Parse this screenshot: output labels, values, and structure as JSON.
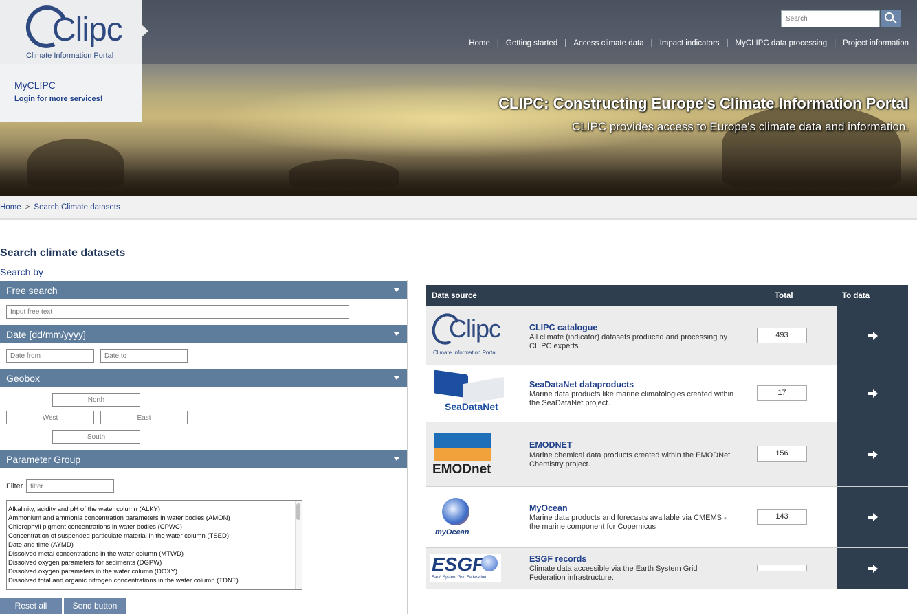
{
  "brand": {
    "logo_text": "Clipc",
    "logo_subtitle": "Climate Information Portal"
  },
  "myclipc": {
    "title": "MyCLIPC",
    "login": "Login for more services!"
  },
  "search": {
    "placeholder": "Search"
  },
  "topnav": [
    "Home",
    "Getting started",
    "Access climate data",
    "Impact indicators",
    "MyCLIPC data processing",
    "Project information"
  ],
  "hero": {
    "title": "CLIPC: Constructing Europe's Climate Information Portal",
    "subtitle": "CLIPC provides access to Europe's climate data and information."
  },
  "breadcrumb": [
    "Home",
    "Search Climate datasets"
  ],
  "page_title": "Search climate datasets",
  "search_by": "Search by",
  "sections": {
    "free_search": {
      "label": "Free search",
      "placeholder": "Input free text"
    },
    "date": {
      "label": "Date [dd/mm/yyyy]",
      "from_placeholder": "Date from",
      "to_placeholder": "Date to"
    },
    "geobox": {
      "label": "Geobox",
      "north": "North",
      "west": "West",
      "east": "East",
      "south": "South"
    },
    "parameter_group": {
      "label": "Parameter Group",
      "filter_label": "Filter",
      "filter_placeholder": "filter",
      "options": [
        "",
        "Alkalinity, acidity and pH of the water column (ALKY)",
        "Ammonium and ammonia concentration parameters in water bodies (AMON)",
        "Chlorophyll pigment concentrations in water bodies (CPWC)",
        "Concentration of suspended particulate material in the water column (TSED)",
        "Date and time (AYMD)",
        "Dissolved metal concentrations in the water column (MTWD)",
        "Dissolved oxygen parameters for sediments (DGPW)",
        "Dissolved oxygen parameters in the water column (DOXY)",
        "Dissolved total and organic nitrogen concentrations in the water column (TDNT)"
      ]
    }
  },
  "buttons": {
    "reset": "Reset all",
    "send": "Send button"
  },
  "results_table": {
    "headers": {
      "source": "Data source",
      "total": "Total",
      "to_data": "To data"
    },
    "rows": [
      {
        "logo": "clipc-logo",
        "logo_text": "Clipc",
        "logo_sub": "Climate Information Portal",
        "title": "CLIPC catalogue",
        "desc": "All climate (indicator) datasets produced and processing by CLIPC experts",
        "total": "493"
      },
      {
        "logo": "seadatanet-logo",
        "logo_text": "SeaDataNet",
        "title": "SeaDataNet dataproducts",
        "desc": "Marine data products like marine climatologies created within the SeaDataNet project.",
        "total": "17"
      },
      {
        "logo": "emodnet-logo",
        "logo_text": "EMODnet",
        "title": "EMODNET",
        "desc": "Marine chemical data products created within the EMODNet Chemistry project.",
        "total": "156"
      },
      {
        "logo": "myocean-logo",
        "logo_text": "myOcean",
        "title": "MyOcean",
        "desc": "Marine data products and forecasts available via CMEMS - the marine component for Copernicus",
        "total": "143"
      },
      {
        "logo": "esgf-logo",
        "logo_text": "ESGF",
        "logo_sub": "Earth System Grid Federation",
        "title": "ESGF records",
        "desc": "Climate data accessible via the Earth System Grid Federation infrastructure.",
        "total": ""
      }
    ]
  },
  "colors": {
    "navy": "#2f3e4f",
    "section_blue": "#5e7c9c",
    "link_blue": "#1f3f8a",
    "button_blue": "#6b86a8"
  }
}
